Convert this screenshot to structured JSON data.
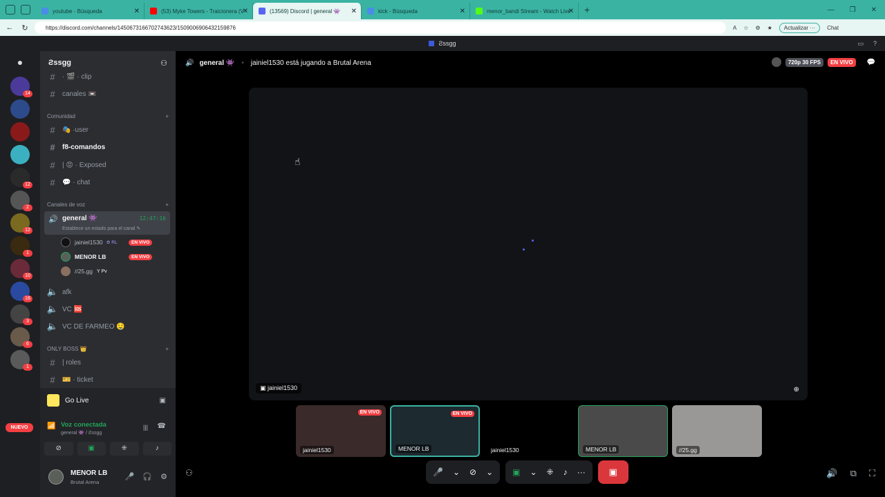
{
  "browser": {
    "tabs": [
      {
        "label": "youtube - Búsqueda",
        "color": "#4a8de8"
      },
      {
        "label": "(53) Myke Towers - Traicionera (V",
        "color": "#ff0000"
      },
      {
        "label": "(13569) Discord | general 👾",
        "color": "#5865f2"
      },
      {
        "label": "kick - Búsqueda",
        "color": "#4a8de8"
      },
      {
        "label": "menor_bandi Stream - Watch Live",
        "color": "#53fc18"
      }
    ],
    "url": "https://discord.com/channels/1450673166702743623/1509006906432159876",
    "update_label": "Actualizar ···",
    "profile_label": "Chat"
  },
  "discord": {
    "window_title": "Ƨssgg",
    "server_name": "Ƨssgg",
    "guild_badges": [
      "14",
      "",
      "",
      "",
      "12",
      "2",
      "12",
      "1",
      "10",
      "16",
      "3",
      "6",
      "1"
    ],
    "nuevo_label": "NUEVO",
    "channels_top": [
      {
        "name": "· 🎬 · clip"
      },
      {
        "name": "canales 📼"
      }
    ],
    "cat_community": "Comunidad",
    "community_channels": [
      {
        "name": "🎭 ·user"
      },
      {
        "name": "f8-comandos"
      },
      {
        "name": "| 😡 · Exposed"
      },
      {
        "name": "💬 · chat"
      }
    ],
    "cat_voice": "Canales de voz",
    "voice_active": {
      "name": "general 👾",
      "time": "12:47:16",
      "status": "Establece un estado para el canal ✎"
    },
    "voice_users": [
      {
        "name": "jainiel1530",
        "tag": "⚙ RL",
        "live": "EN VIVO"
      },
      {
        "name": "MENOR LB",
        "tag": "",
        "live": "EN VIVO"
      },
      {
        "name": "//25.gg",
        "tag": "Y Pv",
        "live": ""
      }
    ],
    "voice_channels": [
      {
        "name": "afk"
      },
      {
        "name": "VC 🆘"
      },
      {
        "name": "VC DE FARMEO 🤤"
      }
    ],
    "cat_boss": "ONLY BOSS 👑",
    "boss_channels": [
      {
        "name": "| roles"
      },
      {
        "name": "🎫 · ticket"
      }
    ],
    "go_live": "Go Live",
    "voice_connected": "Voz conectada",
    "voice_sub": "general 👾 / Ƨssgg",
    "user": {
      "name": "MENOR LB",
      "activity": "Brutal Arena"
    }
  },
  "stage": {
    "channel": "general 👾",
    "activity": "jainiel1530 está jugando a Brutal Arena",
    "quality": "720p 30 FPS",
    "live": "EN VIVO",
    "main_label": "jainiel1530",
    "tiles": [
      {
        "label": "jainiel1530",
        "live": "EN VIVO",
        "bg": "#3a2a2a"
      },
      {
        "label": "MENOR LB",
        "live": "EN VIVO",
        "bg": "#1d2a30"
      },
      {
        "label": "jainiel1530",
        "live": "",
        "bg": "#000000"
      },
      {
        "label": "MENOR LB",
        "live": "",
        "bg": "#4a4a4a"
      },
      {
        "label": "//25.gg",
        "live": "",
        "bg": "#9a9896"
      }
    ]
  },
  "colors": {
    "accent": "#5865f2",
    "live": "#f23f43",
    "online": "#23a55a"
  }
}
